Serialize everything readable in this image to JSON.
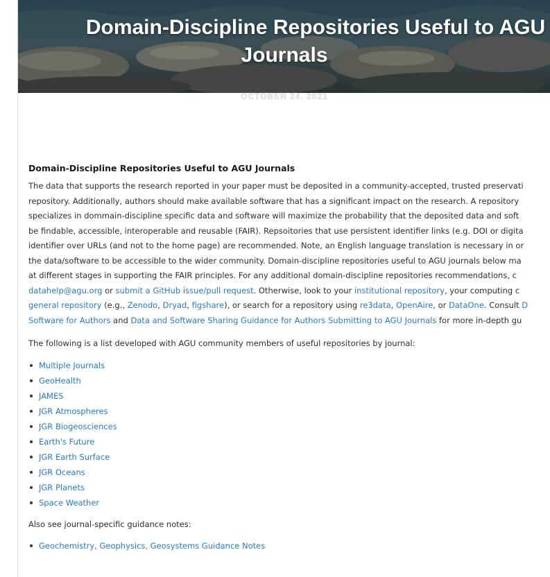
{
  "header": {
    "title_line1": "Domain-Discipline Repositories Useful to AGU",
    "title_line2": "Journals",
    "date": "OCTOBER 24, 2021"
  },
  "article": {
    "heading": "Domain-Discipline Repositories Useful to AGU Journals",
    "para_lines": {
      "l1": "The data that supports the research reported in your paper must be deposited in a community-accepted, trusted preservati",
      "l2": "repository. Additionally, authors should make available software that has a significant impact on the research. A repository",
      "l3": "specializes in dommain-discipline specific data and software will maximize the probability that the deposited data and soft",
      "l4": "be findable, accessible, interoperable and reusable (FAIR). Repsoitories that use persistent identifier links (e.g. DOI or digita",
      "l5": "identifier over URLs (and not to the home page) are recommended. Note, an English language translation is necessary in or",
      "l6": "the data/software to be accessible to the wider community. Domain-discipline repositories useful to AGU journals below ma",
      "l7": "at different stages in supporting the FAIR principles. For any additional domain-discipline repositories recommendations, c",
      "l8_link1": "datahelp@agu.org",
      "l8_t1": " or ",
      "l8_link2": "submit a GitHub issue/pull request",
      "l8_t2": ". Otherwise, look to your ",
      "l8_link3": "institutional repository",
      "l8_t3": ", your computing c",
      "l9_link1": "general repository",
      "l9_t1": " (e.g., ",
      "l9_link2": "Zenodo",
      "l9_t2": ", ",
      "l9_link3": "Dryad",
      "l9_t3": ", ",
      "l9_link4": "figshare",
      "l9_t4": "), or search for a repository using ",
      "l9_link5": "re3data",
      "l9_t5": ", ",
      "l9_link6": "OpenAire",
      "l9_t6": ", or ",
      "l9_link7": "DataOne",
      "l9_t7": ". Consult ",
      "l9_link8": "D",
      "l10_link1": "Software for Authors",
      "l10_t1": " and ",
      "l10_link2": "Data and Software Sharing Guidance for Authors Submitting to AGU Journals",
      "l10_t2": " for more in-depth gu"
    },
    "list_intro": "The following is a list developed with AGU community members of useful repositories by journal:",
    "journals": [
      "Multiple Journals",
      "GeoHealth",
      "JAMES",
      "JGR Atmospheres",
      "JGR Biogeosciences",
      "Earth's Future",
      "JGR Earth Surface",
      "JGR Oceans",
      "JGR Planets",
      "Space Weather"
    ],
    "also_see": "Also see journal-specific guidance notes:",
    "guidance": [
      "Geochemistry, Geophysics, Geosystems Guidance Notes"
    ]
  },
  "colors": {
    "link": "#2a7ab8",
    "text": "#2d2d2d"
  }
}
